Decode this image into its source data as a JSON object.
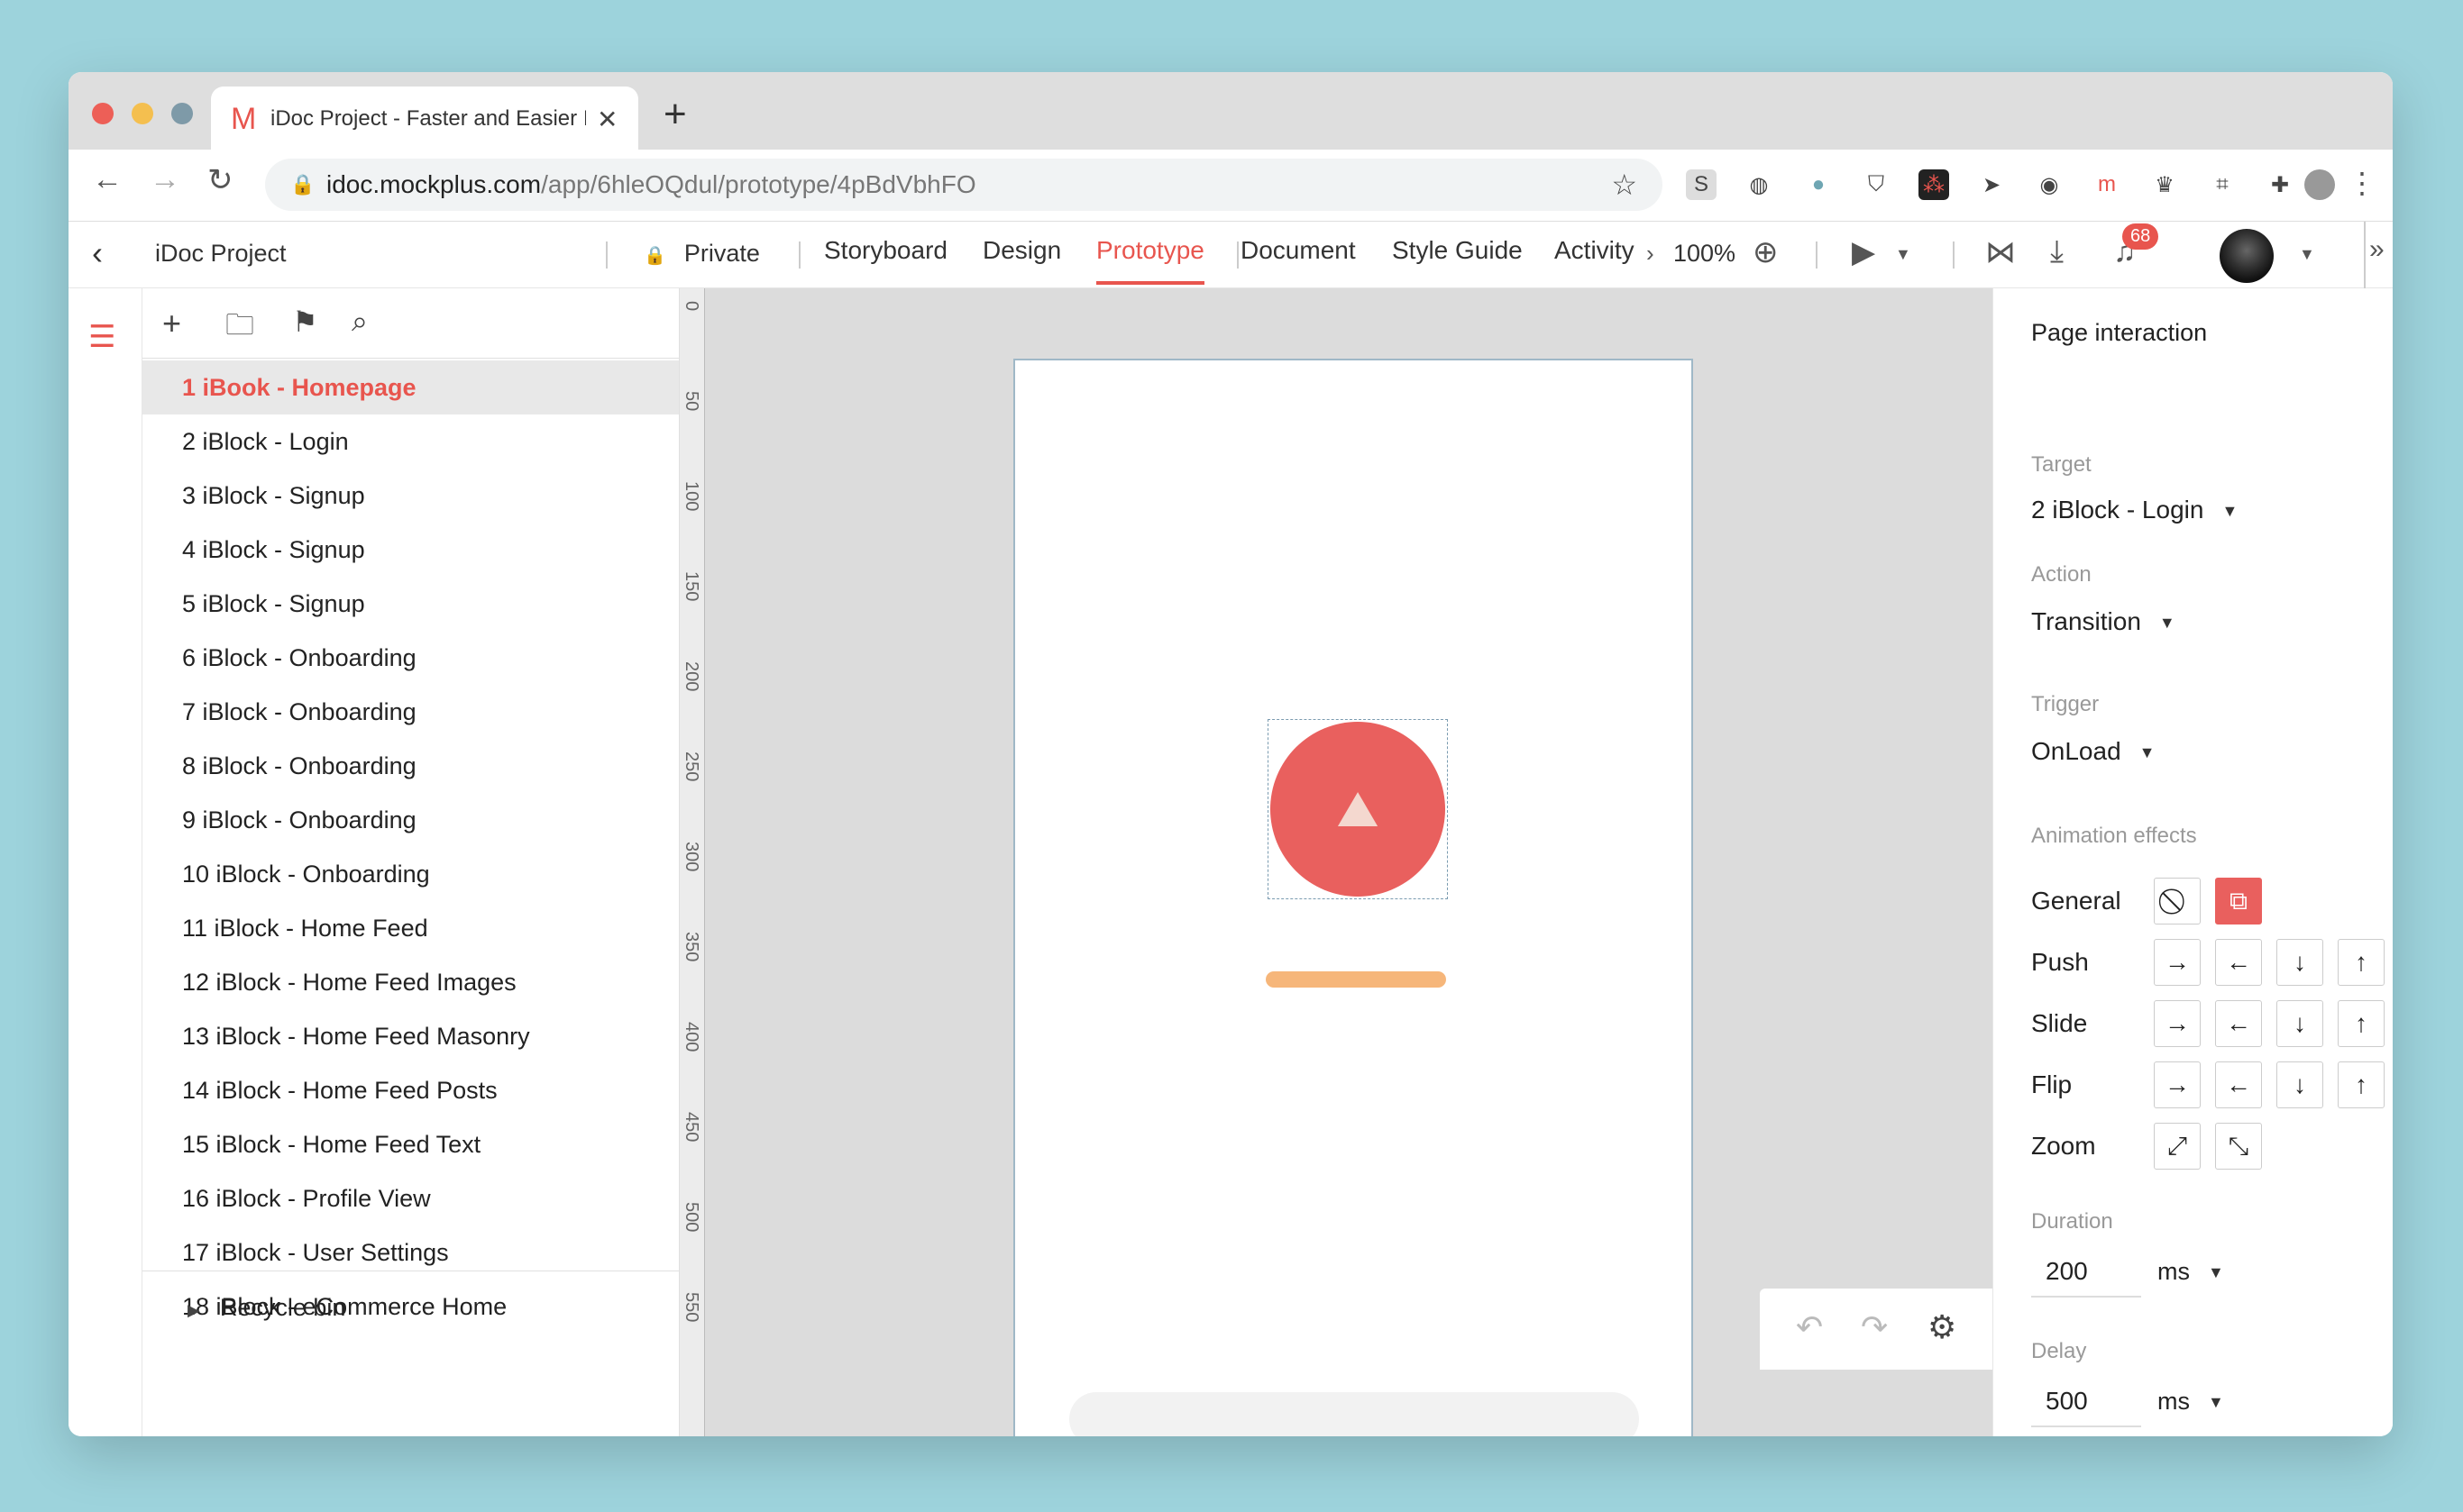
{
  "browser": {
    "tab_title": "iDoc Project - Faster and Easier I",
    "tab_icon": "gmail-m-icon",
    "url_host": "idoc.mockplus.com",
    "url_path": "/app/6hleOQdul/prototype/4pBdVbhFO"
  },
  "header": {
    "project": "iDoc Project",
    "privacy": "Private",
    "tabs": [
      "Storyboard",
      "Design",
      "Prototype",
      "Document",
      "Style Guide",
      "Activity"
    ],
    "active_tab": "Prototype",
    "zoom": "100%",
    "notification_count": "68"
  },
  "pages": {
    "items": [
      "1 iBook - Homepage",
      "2 iBlock - Login",
      "3 iBlock - Signup",
      "4 iBlock - Signup",
      "5 iBlock - Signup",
      "6 iBlock - Onboarding",
      "7 iBlock - Onboarding",
      "8 iBlock - Onboarding",
      "9 iBlock - Onboarding",
      "10 iBlock - Onboarding",
      "11 iBlock - Home Feed",
      "12 iBlock - Home Feed Images",
      "13 iBlock - Home Feed Masonry",
      "14 iBlock - Home Feed Posts",
      "15 iBlock - Home Feed Text",
      "16 iBlock - Profile View",
      "17 iBlock - User Settings",
      "18 iBlock - eCommerce Home"
    ],
    "active_index": 0,
    "recycle_bin": "Recycle bin"
  },
  "ruler": {
    "ticks": [
      "0",
      "50",
      "100",
      "150",
      "200",
      "250",
      "300",
      "350",
      "400",
      "450",
      "500",
      "550"
    ]
  },
  "interaction": {
    "title": "Page interaction",
    "target_label": "Target",
    "target_value": "2 iBlock - Login",
    "action_label": "Action",
    "action_value": "Transition",
    "trigger_label": "Trigger",
    "trigger_value": "OnLoad",
    "animation_label": "Animation effects",
    "rows": [
      {
        "name": "General",
        "buttons": [
          "⃠",
          "⧉"
        ]
      },
      {
        "name": "Push",
        "buttons": [
          "→",
          "←",
          "↓",
          "↑"
        ]
      },
      {
        "name": "Slide",
        "buttons": [
          "→",
          "←",
          "↓",
          "↑"
        ]
      },
      {
        "name": "Flip",
        "buttons": [
          "→",
          "←",
          "↓",
          "↑"
        ]
      },
      {
        "name": "Zoom",
        "buttons": [
          "⤢",
          "⤡"
        ]
      }
    ],
    "duration_label": "Duration",
    "duration_value": "200",
    "duration_unit": "ms",
    "delay_label": "Delay",
    "delay_value": "500",
    "delay_unit": "ms"
  },
  "colors": {
    "accent": "#e8554e",
    "circle": "#e9605e",
    "bar": "#f6b67a"
  }
}
